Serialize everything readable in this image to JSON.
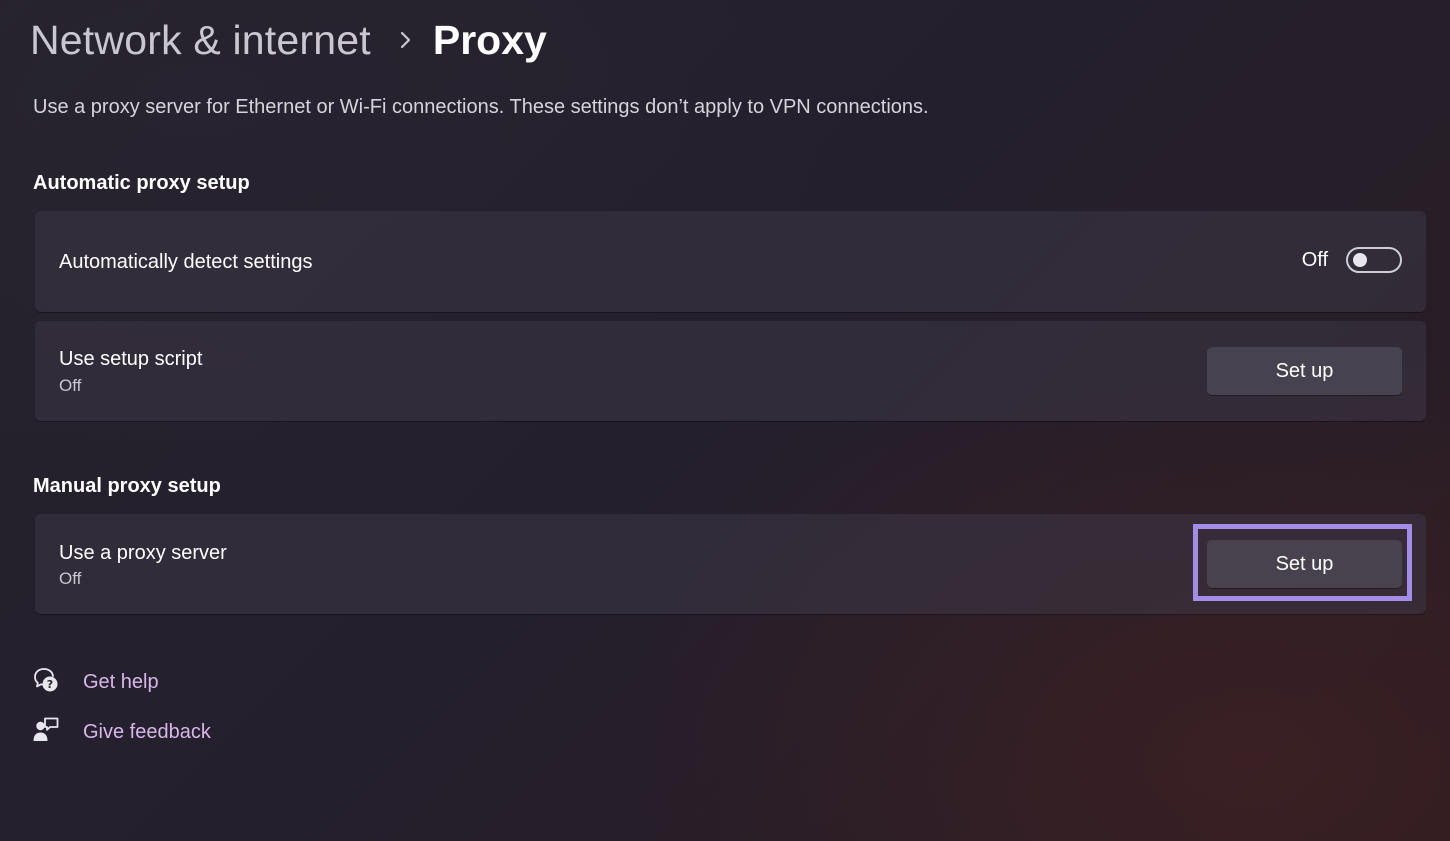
{
  "breadcrumb": {
    "parent": "Network & internet",
    "current": "Proxy",
    "separator_icon": "chevron-right-icon"
  },
  "description": "Use a proxy server for Ethernet or Wi-Fi connections. These settings don’t apply to VPN connections.",
  "automatic": {
    "heading": "Automatic proxy setup",
    "detect": {
      "title": "Automatically detect settings",
      "toggle_label": "Off",
      "toggle_on": false
    },
    "script": {
      "title": "Use setup script",
      "status": "Off",
      "button_label": "Set up"
    }
  },
  "manual": {
    "heading": "Manual proxy setup",
    "proxy_server": {
      "title": "Use a proxy server",
      "status": "Off",
      "button_label": "Set up"
    }
  },
  "links": {
    "help": {
      "label": "Get help",
      "icon": "get-help-icon"
    },
    "feedback": {
      "label": "Give feedback",
      "icon": "give-feedback-icon"
    }
  },
  "colors": {
    "link": "#d9b6ea",
    "highlight": "#a28ee6",
    "card": "#3c3646",
    "button": "#4b4654"
  }
}
